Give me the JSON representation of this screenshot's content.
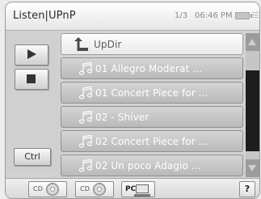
{
  "header": {
    "title": "Listen|UPnP",
    "page_indicator": "1/3",
    "time": "06:46 PM",
    "battery_icon": "battery-icon",
    "menu_icon": "menu-lines-icon"
  },
  "controls": {
    "play_icon": "play-icon",
    "stop_icon": "stop-icon",
    "ctrl_label": "Ctrl"
  },
  "list": {
    "updir_label": "UpDir",
    "updir_icon": "up-arrow-icon",
    "item_icon": "music-note-icon",
    "items": [
      "01 Allegro Moderat ...",
      "01 Concert Piece for ...",
      "02 - Shiver",
      "02 Concert Piece for ...",
      "02 Un poco Adagio ..."
    ]
  },
  "scrollbar": {
    "up_icon": "scroll-up-icon",
    "down_icon": "scroll-down-icon"
  },
  "bottom": {
    "sources": [
      {
        "label": "CD",
        "icon": "cd-icon"
      },
      {
        "label": "CD",
        "icon": "cd-icon"
      },
      {
        "label": "PC",
        "icon": "pc-icon"
      }
    ],
    "help_label": "?"
  }
}
